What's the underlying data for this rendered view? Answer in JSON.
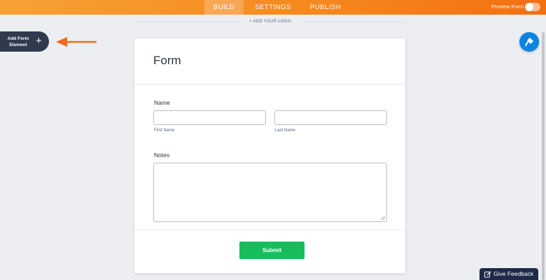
{
  "topbar": {
    "tabs": [
      {
        "label": "BUILD",
        "active": true
      },
      {
        "label": "SETTINGS",
        "active": false
      },
      {
        "label": "PUBLISH",
        "active": false
      }
    ],
    "preview_label": "Preview Form",
    "preview_on": false
  },
  "logo": {
    "add_label": "+ ADD YOUR LOGO"
  },
  "add_element": {
    "label": "Add Form Element",
    "plus": "+"
  },
  "form": {
    "title": "Form",
    "name_label": "Name",
    "first_placeholder": "",
    "last_placeholder": "",
    "first_sublabel": "First Name",
    "last_sublabel": "Last Name",
    "notes_label": "Notes",
    "notes_value": "",
    "submit_label": "Submit"
  },
  "feedback": {
    "label": "Give Feedback"
  },
  "colors": {
    "brand_orange": "#f58a1f",
    "accent_blue": "#0a84e0",
    "submit_green": "#18bd5b",
    "navy": "#2f3a4f"
  }
}
